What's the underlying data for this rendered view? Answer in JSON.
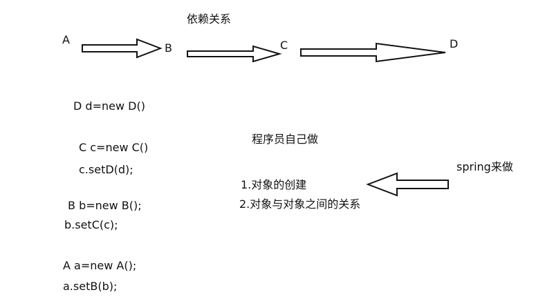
{
  "diagram": {
    "title": "依赖关系",
    "nodes": [
      "A",
      "B",
      "C",
      "D"
    ],
    "code": [
      "D d=new D()",
      "C c=new C()",
      "c.setD(d);",
      "B b=new B();",
      "b.setC(c);",
      "A a=new A();",
      "a.setB(b);"
    ],
    "programmer_label": "程序员自己做",
    "list": [
      "1.对象的创建",
      "2.对象与对象之间的关系"
    ],
    "spring_label": "spring来做"
  }
}
